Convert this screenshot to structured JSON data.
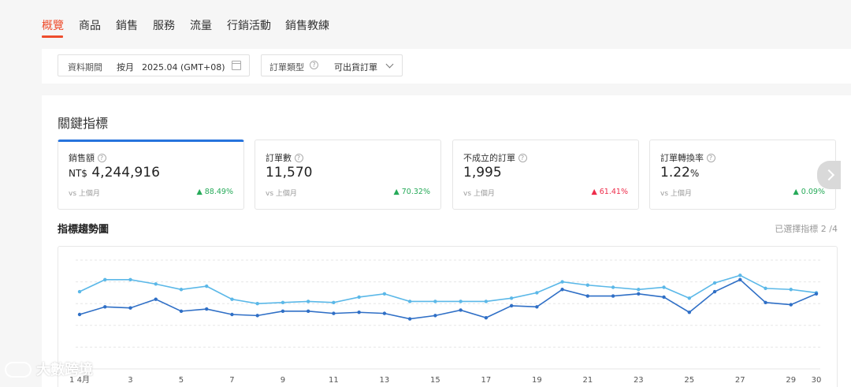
{
  "tabs": [
    "概覽",
    "商品",
    "銷售",
    "服務",
    "流量",
    "行銷活動",
    "銷售教練"
  ],
  "filters": {
    "date_label": "資料期間",
    "date_mode": "按月",
    "date_value": "2025.04 (GMT+08)",
    "order_type_label": "訂單類型",
    "order_type_value": "可出貨訂單"
  },
  "kpi_section": {
    "title": "關鍵指標",
    "cards": [
      {
        "name": "銷售額",
        "prefix": "NT$",
        "value": "4,244,916",
        "unit": "",
        "vs": "vs 上個月",
        "change": "▲ 88.49%",
        "direction": "up",
        "color": "#26aa59"
      },
      {
        "name": "訂單數",
        "prefix": "",
        "value": "11,570",
        "unit": "",
        "vs": "vs 上個月",
        "change": "▲ 70.32%",
        "direction": "up",
        "color": "#26aa59"
      },
      {
        "name": "不成立的訂單",
        "prefix": "",
        "value": "1,995",
        "unit": "",
        "vs": "vs 上個月",
        "change": "▲ 61.41%",
        "direction": "up",
        "color": "#ee2c4a"
      },
      {
        "name": "訂單轉換率",
        "prefix": "",
        "value": "1.22",
        "unit": "%",
        "vs": "vs 上個月",
        "change": "▲ 0.09%",
        "direction": "up",
        "color": "#26aa59"
      }
    ]
  },
  "trend": {
    "title": "指標趨勢圖",
    "selected_count": "已選擇指標 2 /4"
  },
  "chart_data": {
    "type": "line",
    "x": [
      1,
      2,
      3,
      4,
      5,
      6,
      7,
      8,
      9,
      10,
      11,
      12,
      13,
      14,
      15,
      16,
      17,
      18,
      19,
      20,
      21,
      22,
      23,
      24,
      25,
      26,
      27,
      28,
      29,
      30
    ],
    "x_ticks": [
      "1 4月",
      "3",
      "5",
      "7",
      "9",
      "11",
      "13",
      "15",
      "17",
      "19",
      "21",
      "23",
      "25",
      "27",
      "29",
      "30"
    ],
    "series": [
      {
        "color": "#5bb8e8",
        "values": [
          71,
          82,
          82,
          78,
          73,
          76,
          64,
          60,
          61,
          62,
          61,
          66,
          69,
          62,
          62,
          62,
          62,
          65,
          70,
          80,
          77,
          75,
          73,
          75,
          65,
          79,
          86,
          74,
          73,
          70
        ]
      },
      {
        "color": "#2f6fc6",
        "values": [
          50,
          57,
          56,
          64,
          53,
          55,
          50,
          49,
          53,
          53,
          51,
          52,
          51,
          46,
          49,
          54,
          47,
          58,
          57,
          73,
          67,
          67,
          69,
          66,
          52,
          71,
          82,
          61,
          59,
          69
        ]
      }
    ],
    "ylim": [
      0,
      100
    ],
    "grid": true,
    "legend": "none"
  },
  "watermark": "大數跨境"
}
